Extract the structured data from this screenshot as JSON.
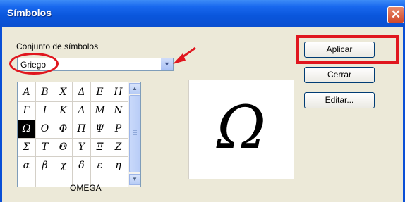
{
  "window": {
    "title": "Símbolos",
    "close_glyph": "✕"
  },
  "charset": {
    "label": "Conjunto de símbolos",
    "selected": "Griego"
  },
  "grid": {
    "rows": [
      [
        "A",
        "B",
        "X",
        "Δ",
        "E",
        "H"
      ],
      [
        "Γ",
        "I",
        "K",
        "Λ",
        "M",
        "N"
      ],
      [
        "Ω",
        "O",
        "Φ",
        "Π",
        "Ψ",
        "P"
      ],
      [
        "Σ",
        "T",
        "Θ",
        "Y",
        "Ξ",
        "Z"
      ],
      [
        "α",
        "β",
        "χ",
        "δ",
        "ε",
        "η"
      ]
    ],
    "selected_row": 2,
    "selected_col": 0
  },
  "selected_char_name": "OMEGA",
  "preview_char": "Ω",
  "buttons": {
    "apply": "Aplicar",
    "close": "Cerrar",
    "edit": "Editar..."
  },
  "accent": {
    "annotation_red": "#e0161e",
    "title_blue": "#0a56dc"
  }
}
